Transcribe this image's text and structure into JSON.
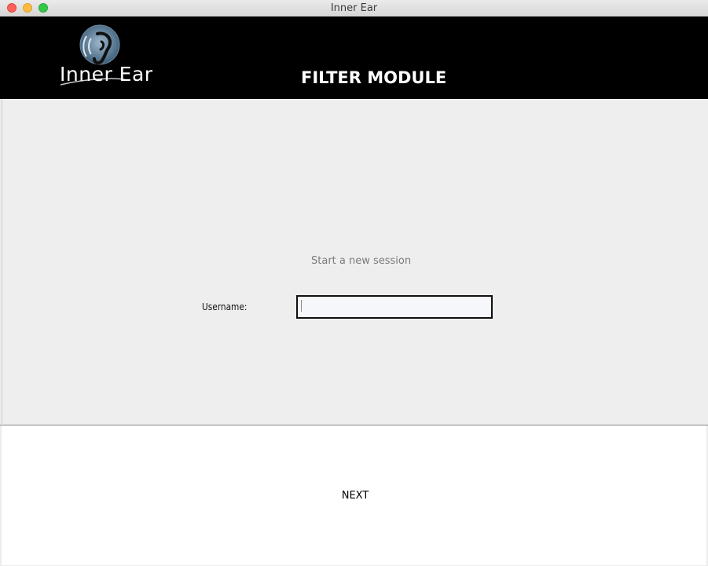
{
  "window": {
    "title": "Inner Ear"
  },
  "header": {
    "logo_text": "Inner Ear",
    "heading": "FILTER MODULE"
  },
  "form": {
    "subtitle": "Start a new session",
    "username_label": "Username:",
    "username_value": ""
  },
  "footer": {
    "next_label": "NEXT"
  },
  "colors": {
    "header_bg": "#000000",
    "panel_bg": "#eeeeee",
    "footer_bg": "#ffffff"
  },
  "icons": {
    "logo": "ear-icon"
  }
}
